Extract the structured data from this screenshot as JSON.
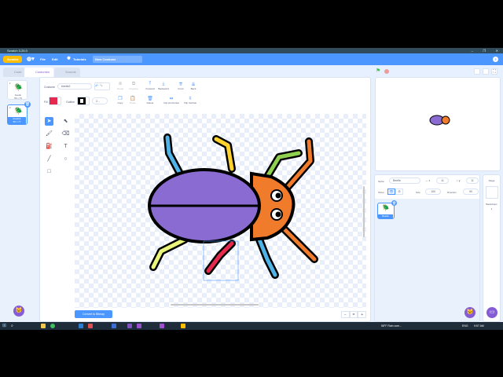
{
  "window": {
    "title": "Scratch 3.25.0",
    "minimize": "–",
    "restore": "❐",
    "close": "✕"
  },
  "menu": {
    "logo": "Scratch",
    "language_icon": "globe-icon",
    "file": "File",
    "edit": "Edit",
    "tutorials": "Tutorials",
    "project_title": "New Costume",
    "help": "?"
  },
  "tabs": [
    {
      "label": "Code"
    },
    {
      "label": "Costumes"
    },
    {
      "label": "Sounds"
    }
  ],
  "costumes": [
    {
      "index": "1",
      "name": "beetle",
      "size": "56 x 73"
    },
    {
      "index": "2",
      "name": "beetle2",
      "size": "56 x 77",
      "selected": true
    }
  ],
  "editor": {
    "costume_label": "Costume",
    "costume_name": "beetle2",
    "fill_label": "Fill",
    "fill_color": "#e6294f",
    "outline_label": "Outline",
    "outline_color": "#000000",
    "outline_width": "2...",
    "buttons": [
      "Group",
      "Ungroup",
      "Forward",
      "Backward",
      "Front",
      "Back",
      "Copy",
      "Paste",
      "Delete",
      "Flip Horizontal",
      "Flip Vertical"
    ],
    "convert_button": "Convert to Bitmap",
    "zoom": {
      "out": "−",
      "reset": "=",
      "in": "+"
    }
  },
  "stage": {
    "green_flag": "green-flag-icon",
    "stop": "stop-icon"
  },
  "sprite_info": {
    "sprite_label": "Sprite",
    "sprite_name": "Beetle",
    "x_label": "x",
    "x": "11",
    "y_label": "y",
    "y": "11",
    "show_label": "Show",
    "size_label": "Size",
    "size": "100",
    "direction_label": "Direction",
    "direction": "90"
  },
  "sprites": [
    {
      "name": "Beetle"
    }
  ],
  "stage_panel": {
    "title": "Stage",
    "backdrops_label": "Backdrops",
    "backdrops_count": "1"
  },
  "taskbar": {
    "weather": "58°F Rain com...",
    "lang": "ENG",
    "time": "9:57 AM"
  },
  "colors": {
    "accent": "#4c97ff",
    "purple": "#855cd6",
    "beetle_body": "#8a6bd1",
    "beetle_head": "#f07b2a"
  }
}
